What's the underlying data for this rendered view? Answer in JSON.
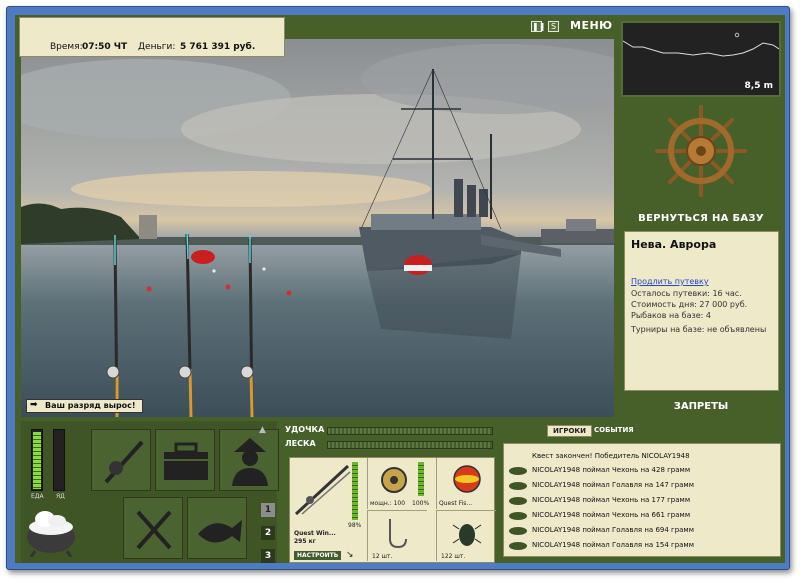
{
  "status": {
    "time_label": "Время:",
    "time_value": "07:50 ЧТ",
    "money_label": "Деньги:",
    "money_value": "5 761 391 руб."
  },
  "topbar": {
    "menu_label": "МЕНЮ",
    "pause_icon": "pause-icon",
    "s_icon_label": "S"
  },
  "notification": {
    "text": "Ваш разряд вырос!"
  },
  "depth": {
    "value": "8,5 m"
  },
  "base": {
    "return_label": "ВЕРНУТЬСЯ НА БАЗУ"
  },
  "location": {
    "title": "Нева. Аврора",
    "extend_link": "Продлить путевку",
    "lines": [
      "Осталось путевки: 16 час.",
      "Стоимость дня: 27 000 руб.",
      "Рыбаков на базе: 4",
      "Турниры на базе: не объявлены"
    ]
  },
  "bans_label": "ЗАПРЕТЫ",
  "meters": {
    "food_label": "ЕДА",
    "poison_label": "ЯД",
    "food_level": 0.95,
    "poison_level": 0.0
  },
  "pages": [
    "1",
    "2",
    "3"
  ],
  "tackle": {
    "rod_label": "УДОЧКА",
    "line_label": "ЛЕСКА",
    "rod_name": "Quest Win...",
    "rod_load": "295 кг",
    "rod_percent": "98%",
    "reel_left": "мощн.: 100",
    "reel_right": "100%",
    "lure_name": "Quest Fis...",
    "hook_count": "12 шт.",
    "bait_count": "122 шт.",
    "tune_label": "НАСТРОИТЬ"
  },
  "log": {
    "tab_players": "ИГРОКИ",
    "tab_events": "СОБЫТИЯ",
    "header": "Квест закончен! Победитель NICOLAY1948",
    "entries": [
      "NICOLAY1948 поймал Чехонь на 428 грамм",
      "NICOLAY1948 поймал Голавля на 147 грамм",
      "NICOLAY1948 поймал Чехонь на 177 грамм",
      "NICOLAY1948 поймал Чехонь на 661 грамм",
      "NICOLAY1948 поймал Голавля на 694 грамм",
      "NICOLAY1948 поймал Голавля на 154 грамм"
    ]
  }
}
